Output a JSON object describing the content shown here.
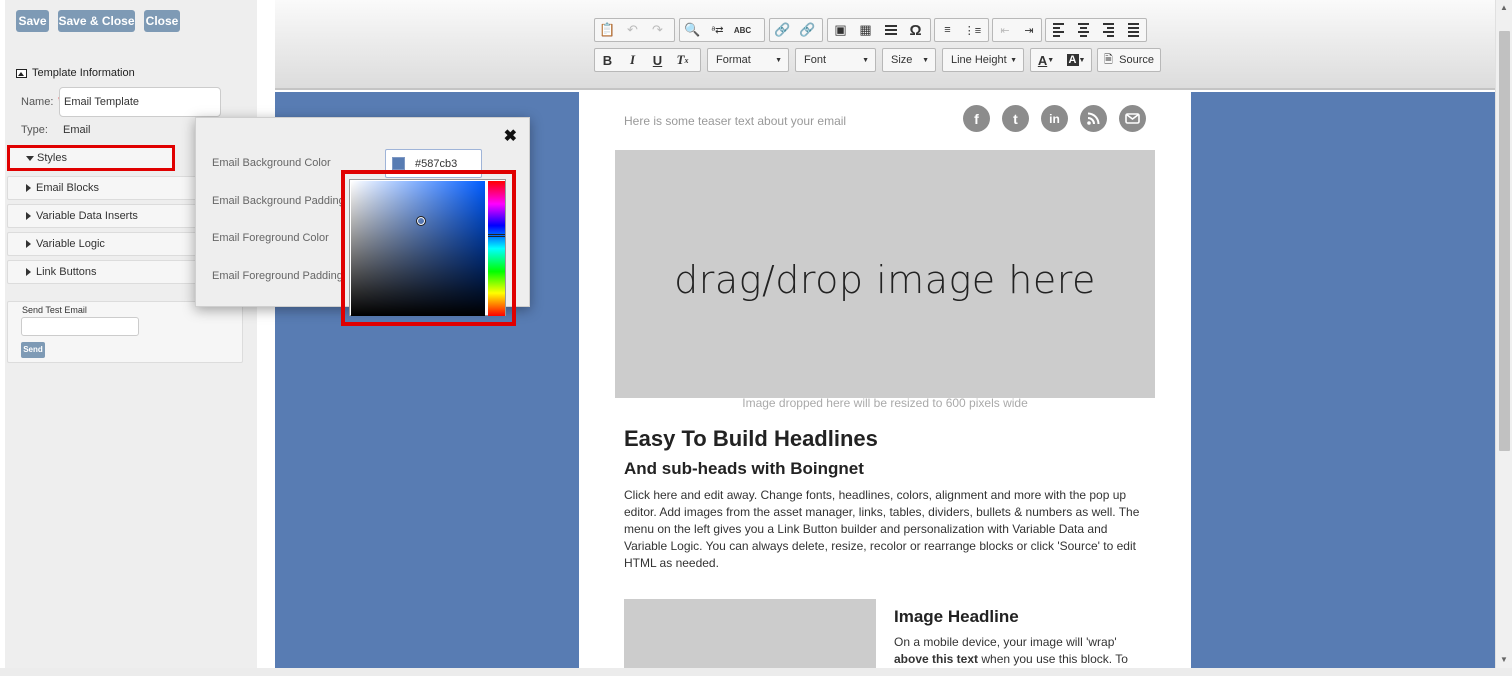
{
  "buttons": {
    "save": "Save",
    "save_close": "Save & Close",
    "close": "Close"
  },
  "template_info": {
    "title": "Template Information",
    "name_label": "Name:",
    "required_mark": "*",
    "name_value": "Email Template",
    "type_label": "Type:",
    "type_value": "Email"
  },
  "accordion": {
    "styles": "Styles",
    "items": [
      "Email Blocks",
      "Variable Data Inserts",
      "Variable Logic",
      "Link Buttons"
    ]
  },
  "send_test": {
    "label": "Send Test Email",
    "button": "Send"
  },
  "toolbar": {
    "format": "Format",
    "font": "Font",
    "size": "Size",
    "line_height": "Line Height",
    "source": "Source",
    "clear_format": "T",
    "omega": "Ω",
    "text_color_letter": "A",
    "bg_color_letter": "A"
  },
  "styles_popup": {
    "email_bg_color_label": "Email Background Color",
    "email_bg_padding_label": "Email Background Padding",
    "email_fg_color_label": "Email Foreground Color",
    "email_fg_padding_label": "Email Foreground Padding",
    "color_value": "#587cb3",
    "close_symbol": "✖"
  },
  "email": {
    "teaser": "Here is some teaser text about your email",
    "social": [
      "f",
      "t",
      "in",
      "rss",
      "mail"
    ],
    "hero_text": "drag/drop image here",
    "hero_caption": "Image dropped here will be resized to 600 pixels wide",
    "headline": "Easy To Build Headlines",
    "subhead": "And sub-heads with Boingnet",
    "body": "Click here and edit away. Change fonts, headlines, colors, alignment and more with the pop up editor. Add images from the asset manager, links, tables, dividers, bullets & numbers as well. The menu on the left gives you a Link Button builder and personalization with Variable Data and Variable Logic. You can always delete, resize, recolor or rearrange blocks or click 'Source' to edit HTML as needed.",
    "image_headline": "Image Headline",
    "body2_start": "On a mobile device, your image will 'wrap' ",
    "body2_bold": "above this text",
    "body2_end": " when you use this block. To"
  },
  "colors": {
    "accent": "#7e9ab5",
    "email_background": "#587cb3",
    "highlight": "#e00000",
    "placeholder_gray": "#cccccc"
  },
  "icons": [
    "paste-icon",
    "undo-icon",
    "redo-icon",
    "find-icon",
    "replace-icon",
    "spellcheck-icon",
    "link-icon",
    "unlink-icon",
    "image-icon",
    "table-icon",
    "horizontal-rule-icon",
    "omega-icon",
    "numbered-list-icon",
    "bullet-list-icon",
    "outdent-icon",
    "indent-icon",
    "align-left-icon",
    "align-center-icon",
    "align-right-icon",
    "justify-icon",
    "bold-icon",
    "italic-icon",
    "underline-icon",
    "clear-format-icon",
    "text-color-icon",
    "bg-color-icon",
    "source-icon",
    "close-icon"
  ]
}
